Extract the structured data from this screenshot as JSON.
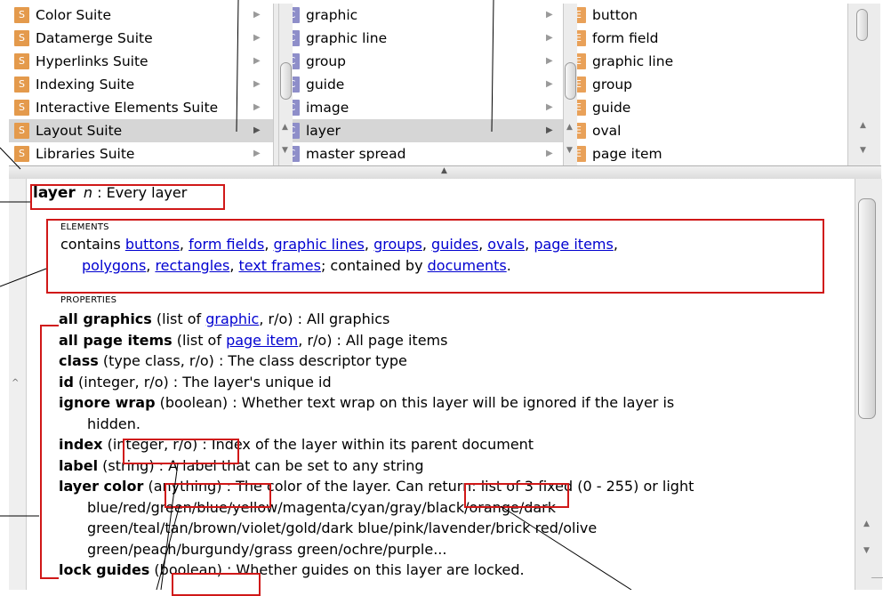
{
  "browser": {
    "suites": [
      {
        "badge": "S",
        "label": "Color Suite"
      },
      {
        "badge": "S",
        "label": "Datamerge Suite"
      },
      {
        "badge": "S",
        "label": "Hyperlinks Suite"
      },
      {
        "badge": "S",
        "label": "Indexing Suite"
      },
      {
        "badge": "S",
        "label": "Interactive Elements Suite"
      },
      {
        "badge": "S",
        "label": "Layout Suite",
        "selected": true
      },
      {
        "badge": "S",
        "label": "Libraries Suite"
      }
    ],
    "classes": [
      {
        "badge": "C",
        "label": "graphic"
      },
      {
        "badge": "C",
        "label": "graphic line"
      },
      {
        "badge": "C",
        "label": "group"
      },
      {
        "badge": "C",
        "label": "guide"
      },
      {
        "badge": "C",
        "label": "image"
      },
      {
        "badge": "C",
        "label": "layer",
        "selected": true
      },
      {
        "badge": "C",
        "label": "master spread"
      }
    ],
    "elements": [
      {
        "badge": "E",
        "label": "button"
      },
      {
        "badge": "E",
        "label": "form field"
      },
      {
        "badge": "E",
        "label": "graphic line"
      },
      {
        "badge": "E",
        "label": "group"
      },
      {
        "badge": "E",
        "label": "guide"
      },
      {
        "badge": "E",
        "label": "oval"
      },
      {
        "badge": "E",
        "label": "page item"
      }
    ]
  },
  "detail": {
    "header": {
      "name": "layer",
      "type": "n",
      "sep": " : ",
      "desc": "Every layer"
    },
    "elements": {
      "caption": "ELEMENTS",
      "contains": "contains",
      "contains_links": [
        "buttons",
        "form fields",
        "graphic lines",
        "groups",
        "guides",
        "ovals",
        "page items",
        "polygons",
        "rectangles",
        "text frames"
      ],
      "contained_by": "; contained by",
      "container_link": "documents",
      "end": "."
    },
    "properties_caption": "PROPERTIES",
    "properties": [
      {
        "name": "all graphics",
        "pre": " (list of ",
        "link": "graphic",
        "post": ", r/o) : All graphics"
      },
      {
        "name": "all page items",
        "pre": " (list of ",
        "link": "page item",
        "post": ", r/o) : All page items"
      },
      {
        "name": "class",
        "post": " (type class, r/o) : The class descriptor type"
      },
      {
        "name": "id",
        "post": " (integer, r/o) : The layer's unique id"
      },
      {
        "name": "ignore wrap",
        "post": " (boolean) : Whether text wrap on this layer will be ignored if the layer is"
      },
      {
        "cont": "hidden."
      },
      {
        "name": "index",
        "post": " (integer, r/o) : Index of the layer within its parent document"
      },
      {
        "name": "label",
        "post": " (string) : A label that can be set to any string"
      },
      {
        "name": "layer color",
        "post": " (anything) : The color of the layer. Can return: list of 3 fixed (0 - 255) or light"
      },
      {
        "cont": "blue/red/green/blue/yellow/magenta/cyan/gray/black/orange/dark"
      },
      {
        "cont": "green/teal/tan/brown/violet/gold/dark blue/pink/lavender/brick red/olive"
      },
      {
        "cont": "green/peach/burgundy/grass green/ochre/purple..."
      },
      {
        "name": "lock guides",
        "post": " (boolean) : Whether guides on this layer are locked."
      }
    ]
  },
  "colors": {
    "callout": "#d01818",
    "link": "#0000d0",
    "selection": "#d6d6d6"
  }
}
